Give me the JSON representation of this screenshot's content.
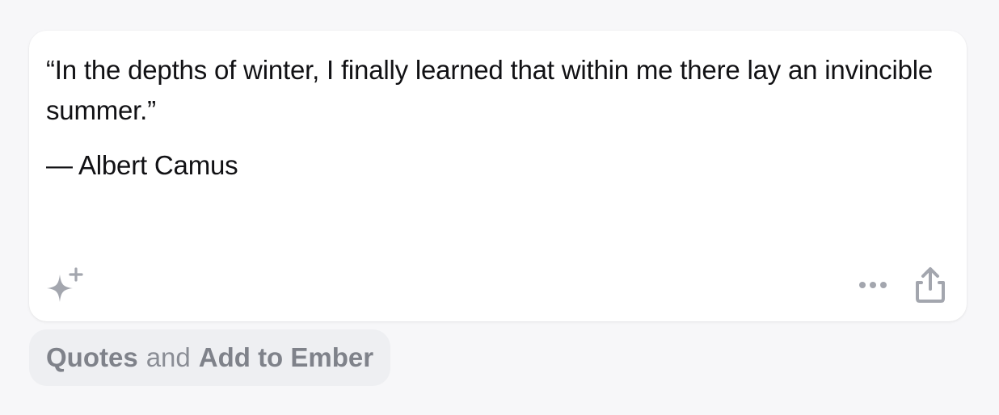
{
  "quote": {
    "text": "“In the depths of winter, I finally learned that within me there lay an invincible summer.”",
    "author": "— Albert Camus"
  },
  "actions": {
    "sparkle_icon": "sparkle-icon",
    "more_icon": "more-horizontal-icon",
    "share_icon": "share-icon"
  },
  "suggestion": {
    "part1": "Quotes",
    "connector": "and",
    "part2": "Add to Ember"
  },
  "colors": {
    "background": "#f7f7f9",
    "card": "#ffffff",
    "text": "#111114",
    "icon": "#a3a6ae",
    "chip_bg": "#eeeff2"
  }
}
